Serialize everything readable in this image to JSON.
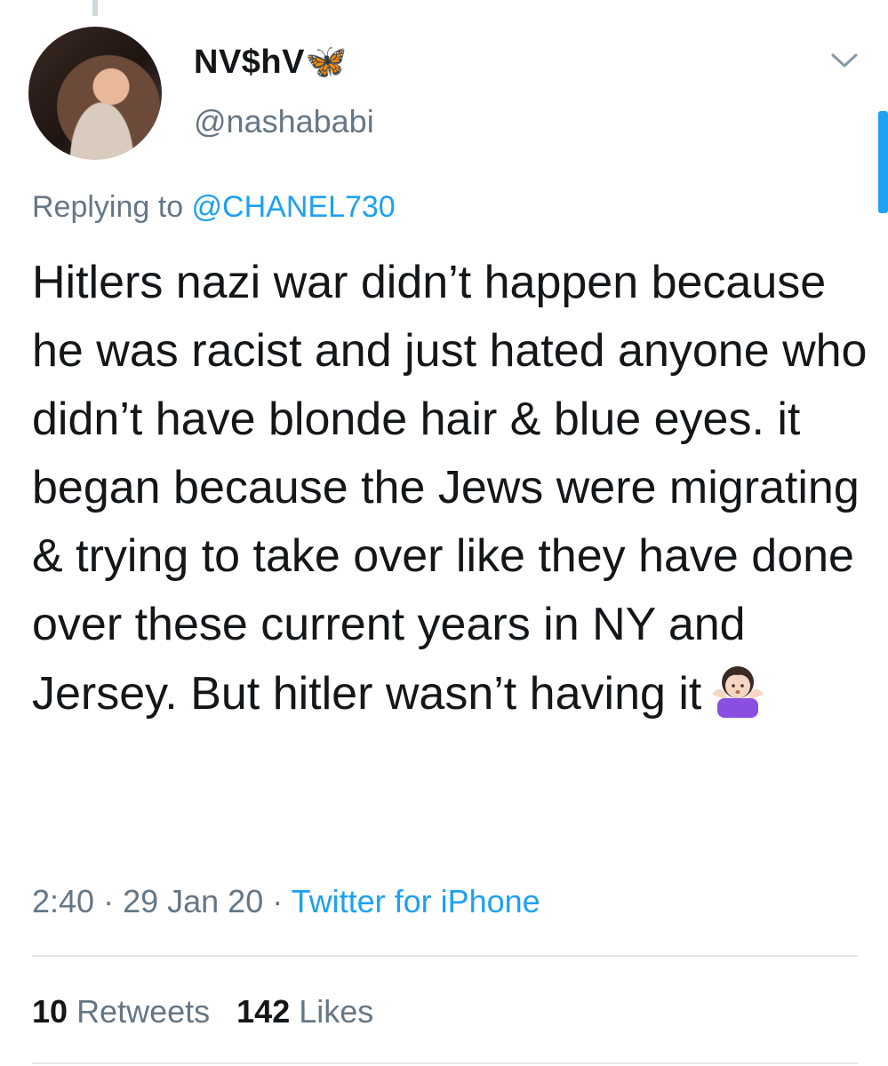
{
  "tweet": {
    "display_name": "NV$hV🦋",
    "handle": "@nashababi",
    "replying_prefix": "Replying to ",
    "replying_mention": "@CHANEL730",
    "text": "Hitlers nazi war didn’t happen because he was racist and just hated anyone who didn’t have blonde hair & blue eyes. it began because the Jews were migrating & trying to take over like they have done over these current years in NY and Jersey. But hitler wasn’t having it",
    "emoji": "person-shrugging-emoji",
    "time": "2:40",
    "date": "29 Jan 20",
    "separator": " · ",
    "source": "Twitter for iPhone"
  },
  "stats": {
    "retweets_count": "10",
    "retweets_label": "Retweets",
    "likes_count": "142",
    "likes_label": "Likes"
  },
  "colors": {
    "accent": "#1da1f2",
    "secondary_text": "#657786",
    "primary_text": "#14171a",
    "divider": "#e1e8ed"
  }
}
